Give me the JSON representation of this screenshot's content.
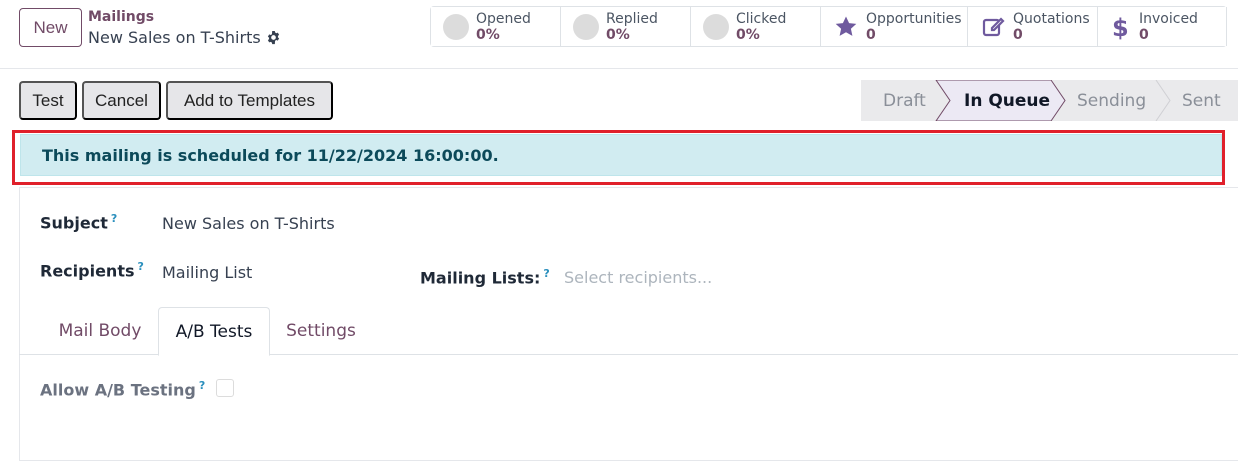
{
  "control_panel": {
    "new_label": "New",
    "breadcrumb_parent": "Mailings",
    "record_title": "New Sales on T-Shirts"
  },
  "stats": [
    {
      "label": "Opened",
      "value": "0%",
      "icon": "circle-icon"
    },
    {
      "label": "Replied",
      "value": "0%",
      "icon": "circle-icon"
    },
    {
      "label": "Clicked",
      "value": "0%",
      "icon": "circle-icon"
    },
    {
      "label": "Opportunities",
      "value": "0",
      "icon": "star-icon"
    },
    {
      "label": "Quotations",
      "value": "0",
      "icon": "edit-icon"
    },
    {
      "label": "Invoiced",
      "value": "0",
      "icon": "dollar-icon"
    }
  ],
  "actions": {
    "test_label": "Test",
    "cancel_label": "Cancel",
    "add_templates_label": "Add to Templates"
  },
  "statusbar": {
    "stages": [
      "Draft",
      "In Queue",
      "Sending",
      "Sent"
    ],
    "active": "In Queue"
  },
  "alert": {
    "message": "This mailing is scheduled for 11/22/2024 16:00:00."
  },
  "form": {
    "subject_label": "Subject",
    "subject_value": "New Sales on T-Shirts",
    "recipients_label": "Recipients",
    "recipients_value": "Mailing List",
    "mailing_lists_label": "Mailing Lists:",
    "mailing_lists_placeholder": "Select recipients...",
    "help_marker": "?"
  },
  "tabs": {
    "items": [
      "Mail Body",
      "A/B Tests",
      "Settings"
    ],
    "active": "A/B Tests"
  },
  "ab_tests": {
    "allow_label": "Allow A/B Testing",
    "allow_checked": false
  },
  "colors": {
    "brand": "#714b67",
    "alert_bg": "#d1ecf1",
    "alert_text": "#0c4a5a",
    "highlight": "#e0202b",
    "help_marker": "#2a8fbd"
  }
}
